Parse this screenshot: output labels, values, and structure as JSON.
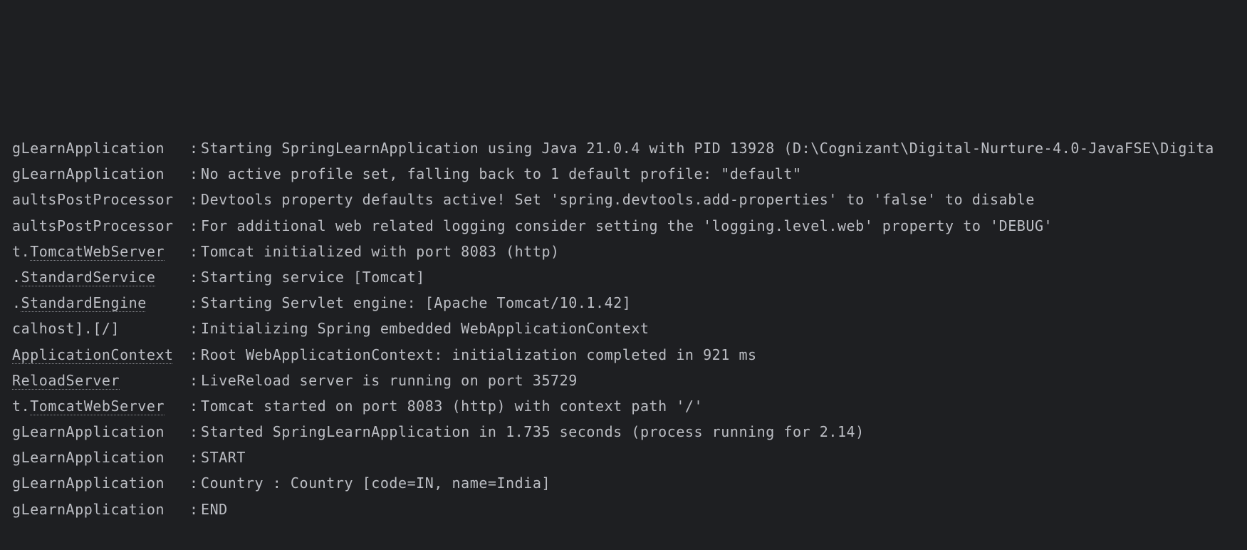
{
  "colors": {
    "background": "#1e1f22",
    "text": "#bcbec4",
    "link_underline": "#8a8c92"
  },
  "console": {
    "separator": ":",
    "lines": [
      {
        "logger_prefix": "gLearnApplication",
        "logger_link": "",
        "message": "Starting SpringLearnApplication using Java 21.0.4 with PID 13928 (D:\\Cognizant\\Digital-Nurture-4.0-JavaFSE\\Digita"
      },
      {
        "logger_prefix": "gLearnApplication",
        "logger_link": "",
        "message": "No active profile set, falling back to 1 default profile: \"default\""
      },
      {
        "logger_prefix": "aultsPostProcessor",
        "logger_link": "",
        "message": "Devtools property defaults active! Set 'spring.devtools.add-properties' to 'false' to disable"
      },
      {
        "logger_prefix": "aultsPostProcessor",
        "logger_link": "",
        "message": "For additional web related logging consider setting the 'logging.level.web' property to 'DEBUG'"
      },
      {
        "logger_prefix": "t.",
        "logger_link": "TomcatWebServer",
        "message": "Tomcat initialized with port 8083 (http)"
      },
      {
        "logger_prefix": ".",
        "logger_link": "StandardService",
        "message": "Starting service [Tomcat]"
      },
      {
        "logger_prefix": ".",
        "logger_link": "StandardEngine",
        "message": "Starting Servlet engine: [Apache Tomcat/10.1.42]"
      },
      {
        "logger_prefix": "calhost].[/]",
        "logger_link": "",
        "message": "Initializing Spring embedded WebApplicationContext"
      },
      {
        "logger_prefix": "",
        "logger_link": "ApplicationContext",
        "message": "Root WebApplicationContext: initialization completed in 921 ms"
      },
      {
        "logger_prefix": "",
        "logger_link": "ReloadServer",
        "message": "LiveReload server is running on port 35729"
      },
      {
        "logger_prefix": "t.",
        "logger_link": "TomcatWebServer",
        "message": "Tomcat started on port 8083 (http) with context path '/'"
      },
      {
        "logger_prefix": "gLearnApplication",
        "logger_link": "",
        "message": "Started SpringLearnApplication in 1.735 seconds (process running for 2.14)"
      },
      {
        "logger_prefix": "gLearnApplication",
        "logger_link": "",
        "message": "START"
      },
      {
        "logger_prefix": "gLearnApplication",
        "logger_link": "",
        "message": "Country : Country [code=IN, name=India]"
      },
      {
        "logger_prefix": "gLearnApplication",
        "logger_link": "",
        "message": "END"
      }
    ]
  }
}
